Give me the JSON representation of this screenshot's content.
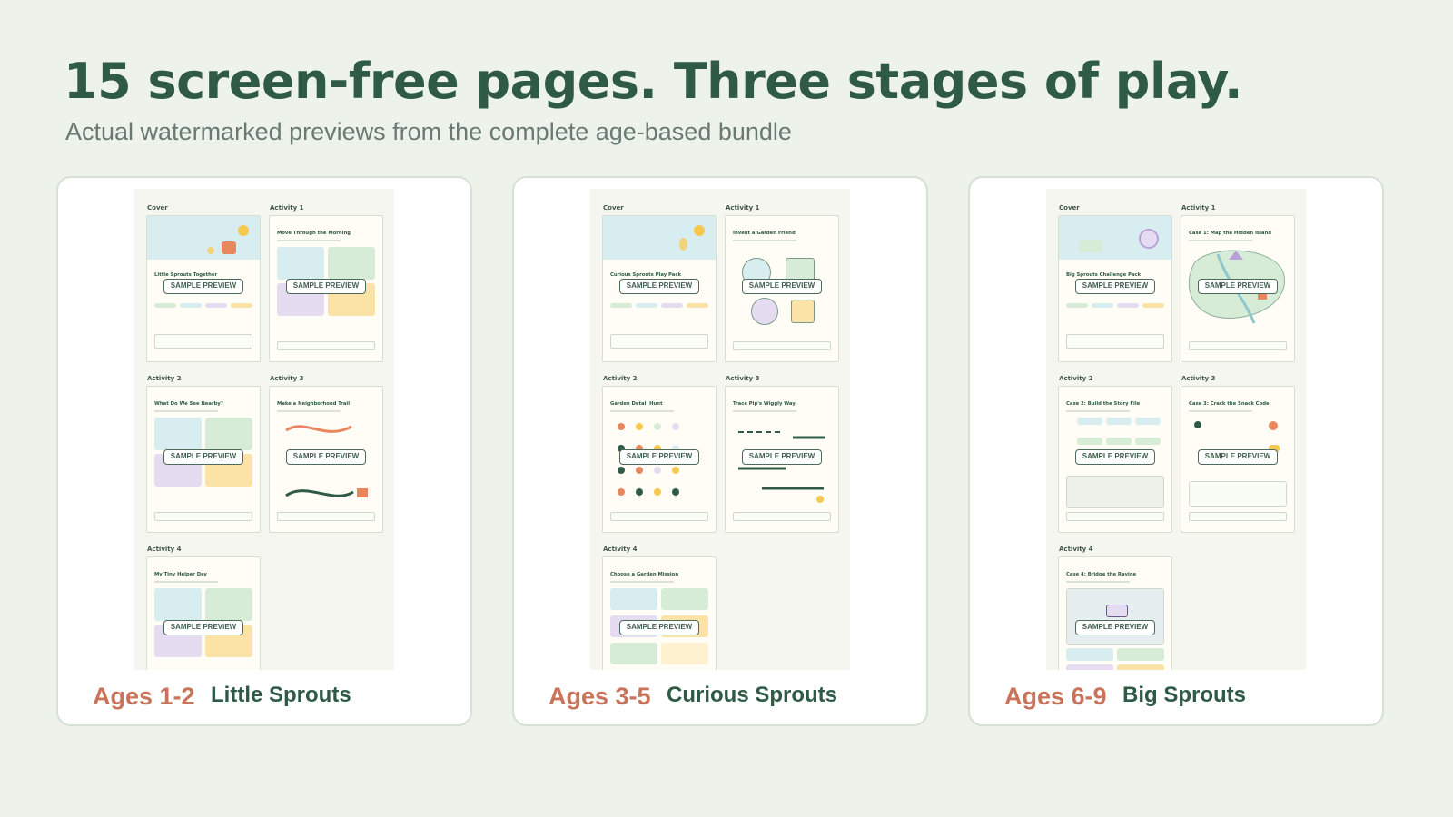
{
  "header": {
    "title": "15 screen-free pages. Three stages of play.",
    "subtitle": "Actual watermarked previews from the complete age-based bundle"
  },
  "colors": {
    "background": "#edf3ea",
    "title": "#2f5a45",
    "age": "#c9745a",
    "stage": "#2f5a45"
  },
  "cards": [
    {
      "age": "Ages 1-2",
      "stage": "Little Sprouts",
      "pages": [
        {
          "caption": "Cover",
          "title": "Little Sprouts Together",
          "watermark": "SAMPLE PREVIEW"
        },
        {
          "caption": "Activity 1",
          "title": "Move Through the Morning",
          "watermark": "SAMPLE PREVIEW"
        },
        {
          "caption": "Activity 2",
          "title": "What Do We See Nearby?",
          "watermark": "SAMPLE PREVIEW"
        },
        {
          "caption": "Activity 3",
          "title": "Make a Neighborhood Trail",
          "watermark": "SAMPLE PREVIEW"
        },
        {
          "caption": "Activity 4",
          "title": "My Tiny Helper Day",
          "watermark": "SAMPLE PREVIEW"
        }
      ]
    },
    {
      "age": "Ages 3-5",
      "stage": "Curious Sprouts",
      "pages": [
        {
          "caption": "Cover",
          "title": "Curious Sprouts Play Pack",
          "watermark": "SAMPLE PREVIEW"
        },
        {
          "caption": "Activity 1",
          "title": "Invent a Garden Friend",
          "watermark": "SAMPLE PREVIEW"
        },
        {
          "caption": "Activity 2",
          "title": "Garden Detail Hunt",
          "watermark": "SAMPLE PREVIEW"
        },
        {
          "caption": "Activity 3",
          "title": "Trace Pip's Wiggly Way",
          "watermark": "SAMPLE PREVIEW"
        },
        {
          "caption": "Activity 4",
          "title": "Choose a Garden Mission",
          "watermark": "SAMPLE PREVIEW"
        }
      ]
    },
    {
      "age": "Ages 6-9",
      "stage": "Big Sprouts",
      "pages": [
        {
          "caption": "Cover",
          "title": "Big Sprouts Challenge Pack",
          "watermark": "SAMPLE PREVIEW"
        },
        {
          "caption": "Activity 1",
          "title": "Case 1: Map the Hidden Island",
          "watermark": "SAMPLE PREVIEW"
        },
        {
          "caption": "Activity 2",
          "title": "Case 2: Build the Story File",
          "watermark": "SAMPLE PREVIEW"
        },
        {
          "caption": "Activity 3",
          "title": "Case 3: Crack the Snack Code",
          "watermark": "SAMPLE PREVIEW"
        },
        {
          "caption": "Activity 4",
          "title": "Case 4: Bridge the Ravine",
          "watermark": "SAMPLE PREVIEW"
        }
      ]
    }
  ]
}
